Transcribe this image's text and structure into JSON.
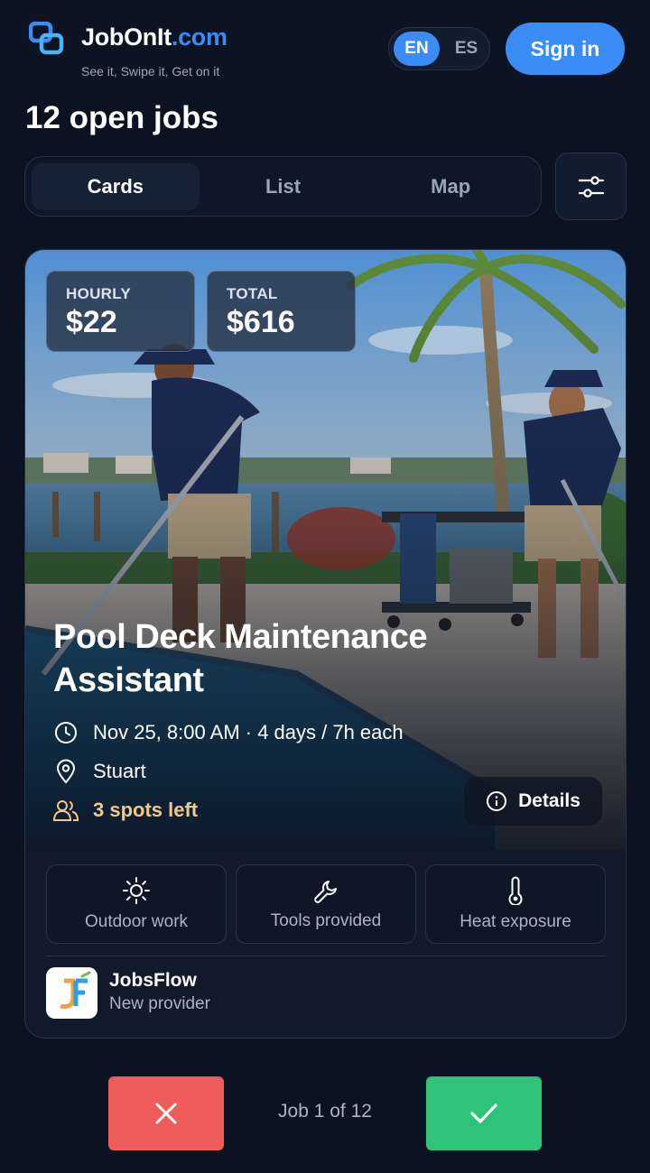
{
  "header": {
    "brand_part1": "JobOnIt",
    "brand_part2": ".com",
    "tagline": "See it, Swipe it, Get on it",
    "languages": [
      "EN",
      "ES"
    ],
    "active_language": "EN",
    "sign_in_label": "Sign in",
    "logo_icon": "chain-link-icon"
  },
  "jobs_count_label": "12 open jobs",
  "views": {
    "tabs": [
      "Cards",
      "List",
      "Map"
    ],
    "active": "Cards",
    "filter_icon": "sliders-icon"
  },
  "card": {
    "hourly": {
      "label": "HOURLY",
      "value": "$22"
    },
    "total": {
      "label": "TOTAL",
      "value": "$616"
    },
    "title": "Pool Deck Maintenance Assistant",
    "schedule": "Nov 25, 8:00 AM · 4 days / 7h each",
    "location": "Stuart",
    "spots": "3 spots left",
    "details_label": "Details",
    "tags": [
      {
        "icon": "sun-icon",
        "label": "Outdoor work"
      },
      {
        "icon": "wrench-icon",
        "label": "Tools provided"
      },
      {
        "icon": "thermometer-icon",
        "label": "Heat exposure"
      }
    ],
    "provider": {
      "name": "JobsFlow",
      "status": "New provider"
    }
  },
  "footer": {
    "pager_label": "Job 1 of 12",
    "reject_icon": "close-icon",
    "accept_icon": "check-icon"
  },
  "colors": {
    "background": "#0b1322",
    "accent": "#3b8cf5",
    "reject": "#ef5d5a",
    "accept": "#2ec27a",
    "spots_highlight": "#f3c98a"
  }
}
